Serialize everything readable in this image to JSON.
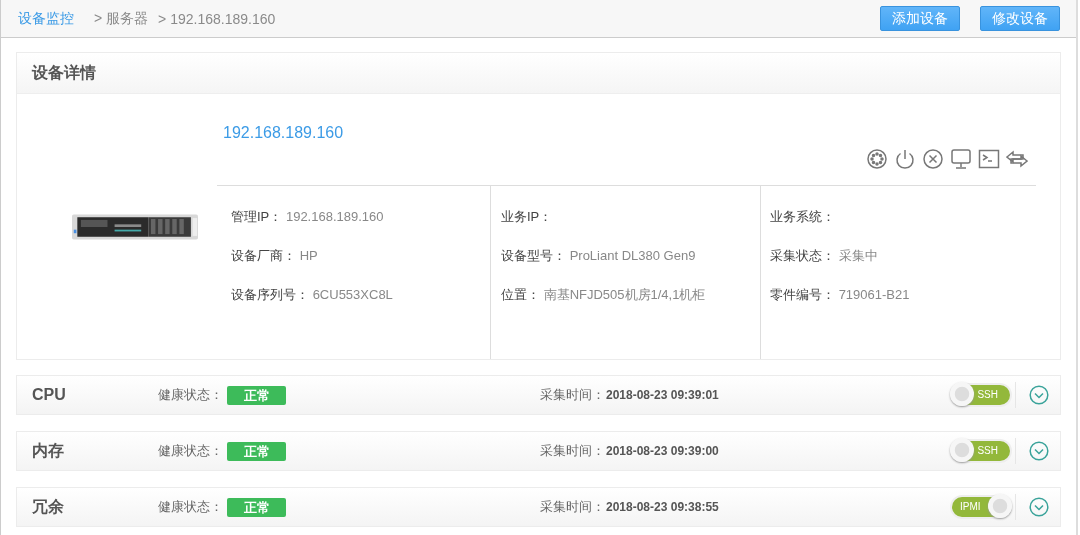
{
  "breadcrumb": {
    "root": "设备监控",
    "items": [
      "> 服务器",
      "> 192.168.189.160"
    ]
  },
  "actions": [
    "添加设备",
    "修改设备"
  ],
  "details": {
    "title": "设备详情",
    "device_ip": "192.168.189.160",
    "columns": [
      [
        {
          "label": "管理IP：",
          "value": "192.168.189.160"
        },
        {
          "label": "设备厂商：",
          "value": "HP"
        },
        {
          "label": "设备序列号：",
          "value": "6CU553XC8L"
        }
      ],
      [
        {
          "label": "业务IP："
        },
        {
          "label": "设备型号：",
          "value": "ProLiant DL380 Gen9"
        },
        {
          "label": "位置：",
          "value": "南基NFJD505机房1/4,1机柜"
        }
      ],
      [
        {
          "label": "业务系统："
        },
        {
          "label": "采集状态：",
          "value": "采集中"
        },
        {
          "label": "零件编号：",
          "value": "719061-B21"
        }
      ]
    ]
  },
  "sections": [
    {
      "name": "CPU",
      "health_label": "健康状态：",
      "health": "正常",
      "time_label": "采集时间：",
      "time": "2018-08-23 09:39:01",
      "protocol": "SSH",
      "on": false
    },
    {
      "name": "内存",
      "health_label": "健康状态：",
      "health": "正常",
      "time_label": "采集时间：",
      "time": "2018-08-23 09:39:00",
      "protocol": "SSH",
      "on": false
    },
    {
      "name": "冗余",
      "health_label": "健康状态：",
      "health": "正常",
      "time_label": "采集时间：",
      "time": "2018-08-23 09:38:55",
      "protocol": "IPMI",
      "on": true
    }
  ]
}
